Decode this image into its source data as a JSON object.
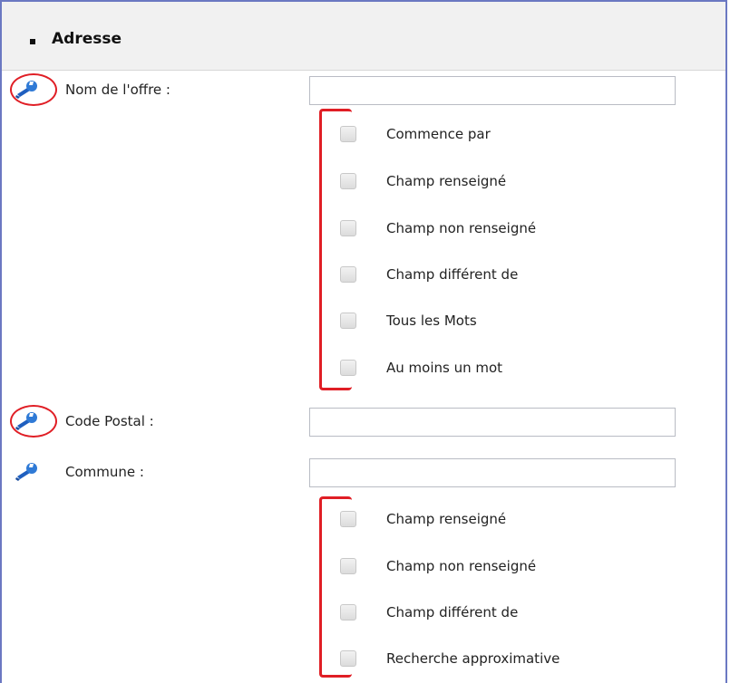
{
  "section": {
    "title": "Adresse"
  },
  "fields": [
    {
      "label": "Nom de l'offre :",
      "value": "",
      "placeholder": ""
    },
    {
      "label": "Code Postal :",
      "value": "",
      "placeholder": ""
    },
    {
      "label": "Commune :",
      "value": "",
      "placeholder": ""
    }
  ],
  "options_nom": [
    "Commence par",
    "Champ renseigné",
    "Champ non renseigné",
    "Champ différent de",
    "Tous les Mots",
    "Au moins un mot"
  ],
  "options_commune": [
    "Champ renseigné",
    "Champ non renseigné",
    "Champ différent de",
    "Recherche approximative"
  ],
  "icons": {
    "field_icon": "wrench-icon"
  },
  "colors": {
    "accent_blue": "#2f6fd0",
    "annotation_red": "#e01e25",
    "frame_border": "#6b78c2"
  }
}
